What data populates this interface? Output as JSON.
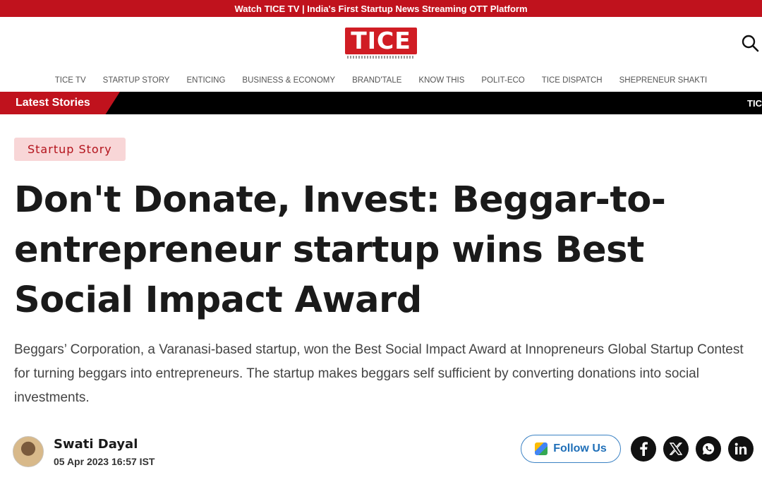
{
  "topbar": {
    "text": "Watch TICE TV | India's First Startup News Streaming OTT Platform"
  },
  "logo": {
    "text": "TICE"
  },
  "nav": {
    "items": [
      "TICE TV",
      "STARTUP STORY",
      "ENTICING",
      "BUSINESS & ECONOMY",
      "BRAND'TALE",
      "KNOW THIS",
      "POLIT-ECO",
      "TICE DISPATCH",
      "SHEPRENEUR SHAKTI"
    ]
  },
  "ticker": {
    "label": "Latest Stories",
    "text": "TIC"
  },
  "article": {
    "category": "Startup Story",
    "headline": "Don't Donate, Invest: Beggar-to-entrepreneur startup wins Best Social Impact Award",
    "summary": "Beggars’ Corporation, a Varanasi-based startup, won the Best Social Impact Award at Innopreneurs Global Startup Contest for turning beggars into entrepreneurs. The startup makes beggars self sufficient by converting donations into social investments.",
    "author": "Swati Dayal",
    "date": "05 Apr 2023 16:57 IST"
  },
  "share": {
    "follow_label": "Follow Us",
    "icons": [
      "facebook-icon",
      "x-icon",
      "whatsapp-icon",
      "linkedin-icon"
    ]
  },
  "colors": {
    "brand_red": "#c0121d",
    "badge_bg": "#f8d6d7",
    "follow_blue": "#1f6fb8"
  }
}
